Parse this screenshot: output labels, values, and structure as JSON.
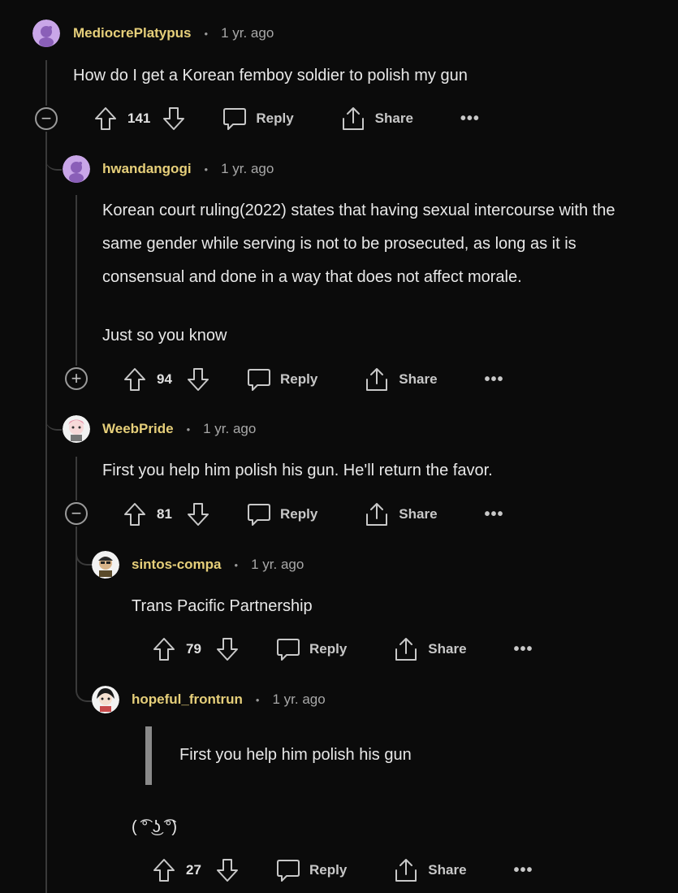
{
  "comments": [
    {
      "username": "MediocrePlatypus",
      "time": "1 yr. ago",
      "body": [
        "How do I get a Korean femboy soldier to polish my gun"
      ],
      "score": "141",
      "reply": "Reply",
      "share": "Share"
    },
    {
      "username": "hwandangogi",
      "time": "1 yr. ago",
      "body": [
        "Korean court ruling(2022) states that having sexual intercourse with the",
        "same gender while serving is not to be prosecuted, as long as it is",
        "consensual and done in a way that does not affect morale.",
        "Just so you know"
      ],
      "score": "94",
      "reply": "Reply",
      "share": "Share"
    },
    {
      "username": "WeebPride",
      "time": "1 yr. ago",
      "body": [
        "First you help him polish his gun. He'll return the favor."
      ],
      "score": "81",
      "reply": "Reply",
      "share": "Share"
    },
    {
      "username": "sintos-compa",
      "time": "1 yr. ago",
      "body": [
        "Trans Pacific Partnership"
      ],
      "score": "79",
      "reply": "Reply",
      "share": "Share"
    },
    {
      "username": "hopeful_frontrun",
      "time": "1 yr. ago",
      "quote": "First you help him polish his gun",
      "body": [
        "( ͡° ͜ʖ ͡°)"
      ],
      "score": "27",
      "reply": "Reply",
      "share": "Share"
    }
  ],
  "icons": {
    "more": "•••",
    "collapse": "−",
    "expand": "+"
  },
  "colors": {
    "background": "#0b0b0b",
    "username": "#e6cf7a",
    "text": "#e8e8e8",
    "thread": "#3a3a3a"
  }
}
